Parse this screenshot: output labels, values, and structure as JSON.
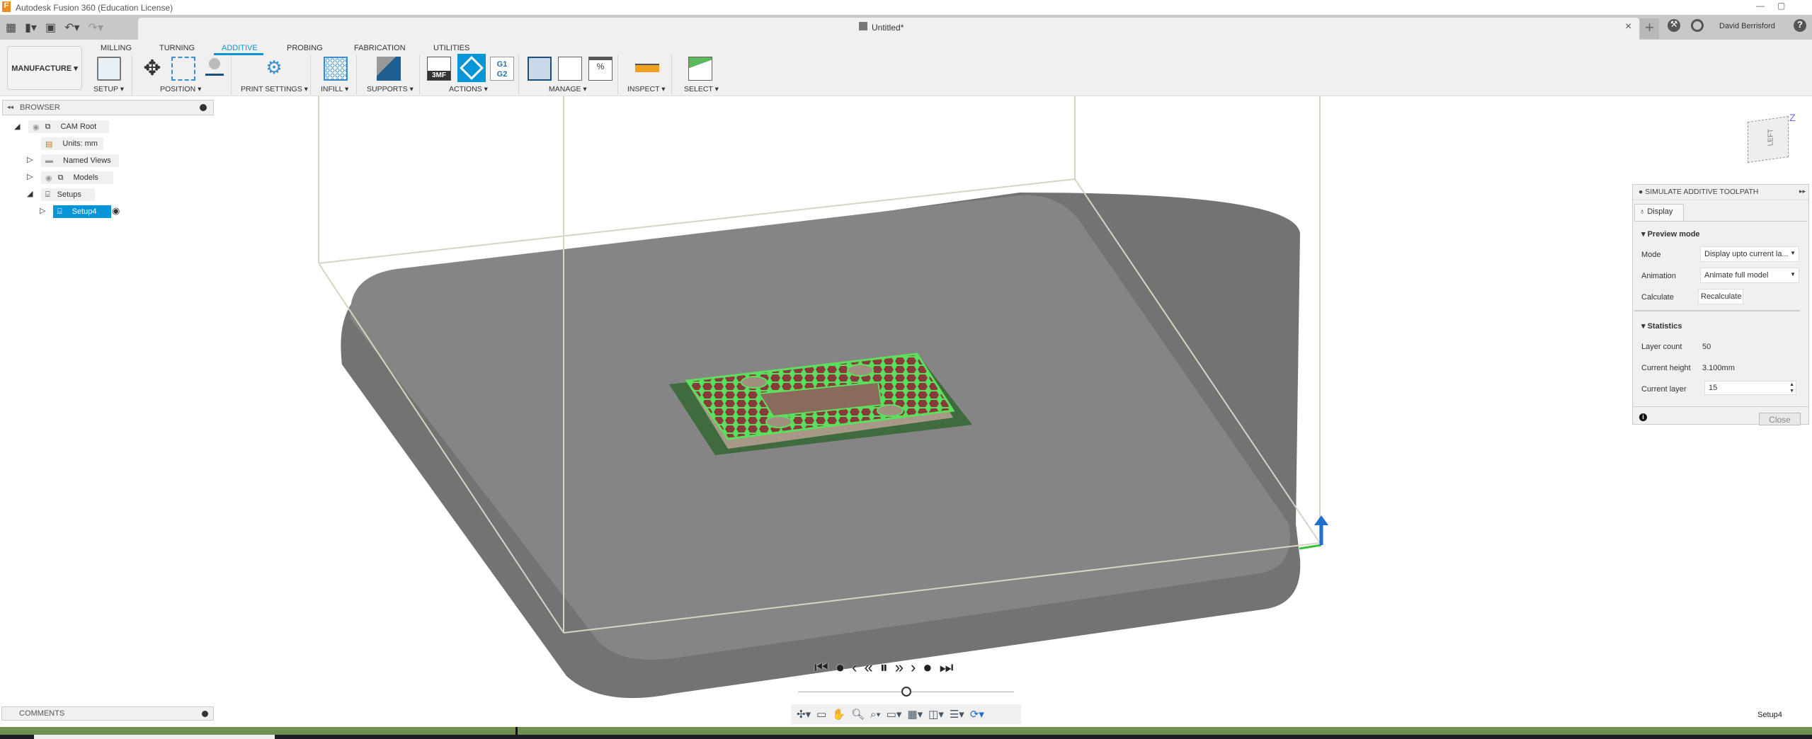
{
  "app": {
    "title": "Autodesk Fusion 360 (Education License)",
    "document": "Untitled*",
    "user": "David Berrisford"
  },
  "toolbar": {
    "workspace": "MANUFACTURE ▾",
    "tabs": [
      "MILLING",
      "TURNING",
      "ADDITIVE",
      "PROBING",
      "FABRICATION",
      "UTILITIES"
    ],
    "active_tab": "ADDITIVE",
    "groups": [
      "SETUP ▾",
      "POSITION ▾",
      "PRINT SETTINGS ▾",
      "INFILL ▾",
      "SUPPORTS ▾",
      "ACTIONS ▾",
      "MANAGE ▾",
      "INSPECT ▾",
      "SELECT ▾"
    ],
    "accent": "#0696d7"
  },
  "browser": {
    "title": "BROWSER",
    "items": [
      {
        "label": "CAM Root"
      },
      {
        "label": "Units: mm"
      },
      {
        "label": "Named Views"
      },
      {
        "label": "Models"
      },
      {
        "label": "Setups"
      },
      {
        "label": "Setup4"
      }
    ]
  },
  "viewcube": {
    "face": "LEFT",
    "axis": "Z"
  },
  "simulate": {
    "title": "SIMULATE ADDITIVE TOOLPATH",
    "tab": "Display",
    "preview_heading": "Preview mode",
    "mode_label": "Mode",
    "mode_value": "Display upto current la...",
    "animation_label": "Animation",
    "animation_value": "Animate full model",
    "calculate_label": "Calculate",
    "recalculate": "Recalculate",
    "stats_heading": "Statistics",
    "layer_count_label": "Layer count",
    "layer_count": "50",
    "height_label": "Current height",
    "height": "3.100mm",
    "layer_label": "Current layer",
    "layer": "15",
    "close": "Close"
  },
  "playback": {
    "position": 0.5
  },
  "comments": {
    "title": "COMMENTS"
  },
  "status": {
    "active_setup": "Setup4"
  }
}
